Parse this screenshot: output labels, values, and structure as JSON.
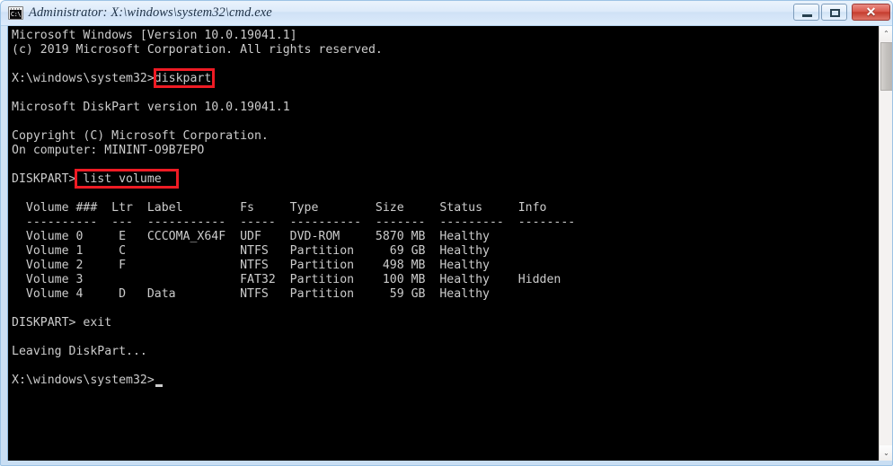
{
  "window": {
    "title": "Administrator: X:\\windows\\system32\\cmd.exe",
    "icon": "console-icon",
    "icon_glyph": "C:\\",
    "accent_border": "#9cc3e5",
    "console_background": "#000000",
    "console_foreground": "#cccccc"
  },
  "titlebar": {
    "minimize_label": "",
    "maximize_label": "",
    "close_label": "✕"
  },
  "scrollbar": {
    "up_arrow": "⌃",
    "down_arrow": "⌄"
  },
  "annotations": {
    "highlight_color": "#ee1b24",
    "boxes": [
      {
        "name": "diskpart-command",
        "text": "diskpart"
      },
      {
        "name": "list-volume-command",
        "text": "list volume"
      }
    ]
  },
  "console": {
    "lines": [
      "Microsoft Windows [Version 10.0.19041.1]",
      "(c) 2019 Microsoft Corporation. All rights reserved.",
      "",
      "X:\\windows\\system32>diskpart",
      "",
      "Microsoft DiskPart version 10.0.19041.1",
      "",
      "Copyright (C) Microsoft Corporation.",
      "On computer: MININT-O9B7EPO",
      "",
      "DISKPART> list volume",
      "",
      "  Volume ###  Ltr  Label        Fs     Type        Size     Status     Info",
      "  ----------  ---  -----------  -----  ----------  -------  ---------  --------",
      "  Volume 0     E   CCCOMA_X64F  UDF    DVD-ROM     5870 MB  Healthy",
      "  Volume 1     C                NTFS   Partition     69 GB  Healthy",
      "  Volume 2     F                NTFS   Partition    498 MB  Healthy",
      "  Volume 3                      FAT32  Partition    100 MB  Healthy    Hidden",
      "  Volume 4     D   Data         NTFS   Partition     59 GB  Healthy",
      "",
      "DISKPART> exit",
      "",
      "Leaving DiskPart...",
      "",
      "X:\\windows\\system32>"
    ],
    "prompt_host": "X:\\windows\\system32>",
    "diskpart_prompt": "DISKPART>",
    "computer_name": "MININT-O9B7EPO",
    "diskpart_version": "10.0.19041.1",
    "windows_version": "10.0.19041.1",
    "copyright_year": "2019",
    "table": {
      "headers": [
        "Volume ###",
        "Ltr",
        "Label",
        "Fs",
        "Type",
        "Size",
        "Status",
        "Info"
      ],
      "rows": [
        {
          "volume": "Volume 0",
          "ltr": "E",
          "label": "CCCOMA_X64F",
          "fs": "UDF",
          "type": "DVD-ROM",
          "size": "5870 MB",
          "status": "Healthy",
          "info": ""
        },
        {
          "volume": "Volume 1",
          "ltr": "C",
          "label": "",
          "fs": "NTFS",
          "type": "Partition",
          "size": "69 GB",
          "status": "Healthy",
          "info": ""
        },
        {
          "volume": "Volume 2",
          "ltr": "F",
          "label": "",
          "fs": "NTFS",
          "type": "Partition",
          "size": "498 MB",
          "status": "Healthy",
          "info": ""
        },
        {
          "volume": "Volume 3",
          "ltr": "",
          "label": "",
          "fs": "FAT32",
          "type": "Partition",
          "size": "100 MB",
          "status": "Healthy",
          "info": "Hidden"
        },
        {
          "volume": "Volume 4",
          "ltr": "D",
          "label": "Data",
          "fs": "NTFS",
          "type": "Partition",
          "size": "59 GB",
          "status": "Healthy",
          "info": ""
        }
      ]
    },
    "commands_entered": [
      "diskpart",
      "list volume",
      "exit"
    ],
    "exit_message": "Leaving DiskPart..."
  }
}
